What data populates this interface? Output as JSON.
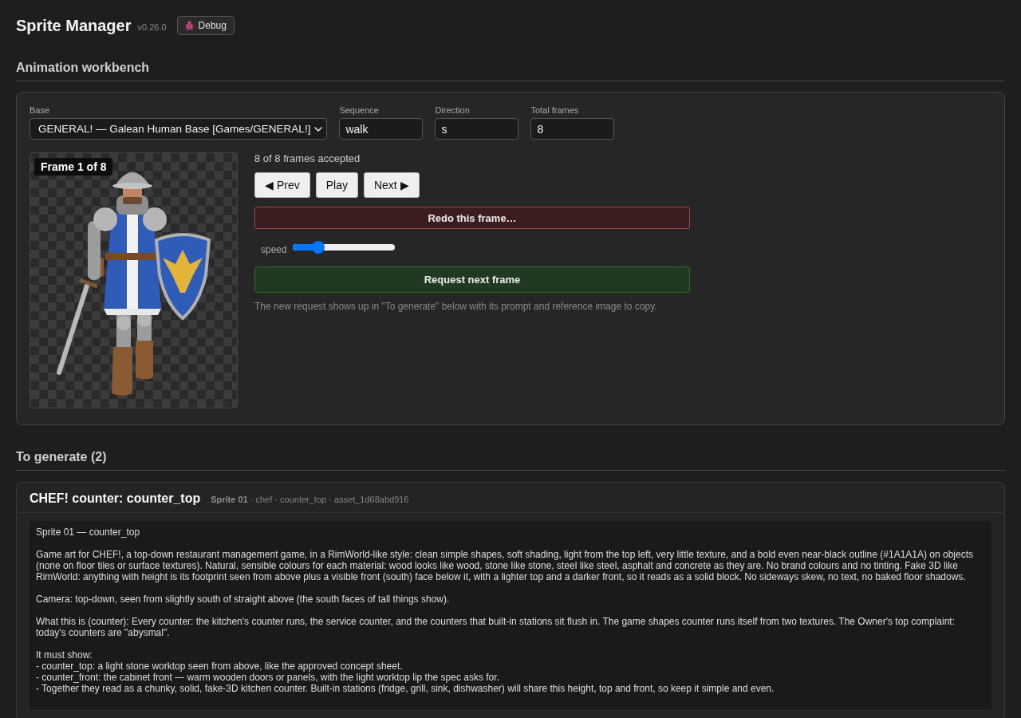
{
  "app": {
    "title": "Sprite Manager",
    "version": "v0.26.0",
    "debug_button": "Debug"
  },
  "workbench": {
    "heading": "Animation workbench",
    "fields": [
      {
        "kind": "select",
        "label": "Base",
        "value": "GENERAL! — Galean Human Base [Games/GENERAL!]"
      },
      {
        "kind": "text",
        "label": "Sequence",
        "value": "walk"
      },
      {
        "kind": "text",
        "label": "Direction",
        "value": "s"
      },
      {
        "kind": "text",
        "label": "Total frames",
        "value": "8"
      }
    ],
    "frame_badge": "Frame 1 of 8",
    "status": "8 of 8 frames accepted",
    "nav_buttons": [
      "◀ Prev",
      "Play",
      "Next ▶"
    ],
    "redo_button": "Redo this frame…",
    "speed": {
      "label": "speed",
      "level": 0.22
    },
    "request_button": "Request next frame",
    "note": "The new request shows up in \"To generate\" below with its prompt and reference image to copy."
  },
  "queue": {
    "heading": "To generate (2)",
    "items": [
      {
        "title": "CHEF! counter: counter_top",
        "meta": "**Sprite 01** · chef · counter_top · asset_1d68abd916",
        "prompt": {
          "title": "Sprite 01 — counter_top",
          "paragraphs": [
            "Game art for CHEF!, a top-down restaurant management game, in a RimWorld-like style: clean simple shapes, soft shading, light from the top left, very little texture, and a bold even near-black outline (#1A1A1A) on objects (none on floor tiles or surface textures). Natural, sensible colours for each material: wood looks like wood, stone like stone, steel like steel, asphalt and concrete as they are. No brand colours and no tinting. Fake 3D like RimWorld: anything with height is its footprint seen from above plus a visible front (south) face below it, with a lighter top and a darker front, so it reads as a solid block. No sideways skew, no text, no baked floor shadows.",
            "Camera: top-down, seen from slightly south of straight above (the south faces of tall things show).",
            "What this is (counter): Every counter: the kitchen's counter runs, the service counter, and the counters that built-in stations sit flush in. The game shapes counter runs itself from two textures. The Owner's top complaint: today's counters are \"abysmal\"."
          ],
          "must_show": {
            "label": "It must show:",
            "items": [
              "- counter_top: a light stone worktop seen from above, like the approved concept sheet.",
              "- counter_front: the cabinet front — warm wooden doors or panels, with the light worktop lip the spec asks for.",
              "- Together they read as a chunky, solid, fake-3D kitchen counter. Built-in stations (fridge, grill, sink, dishwasher) will share this height, top and front, so keep it simple and even."
            ]
          }
        }
      }
    ]
  }
}
